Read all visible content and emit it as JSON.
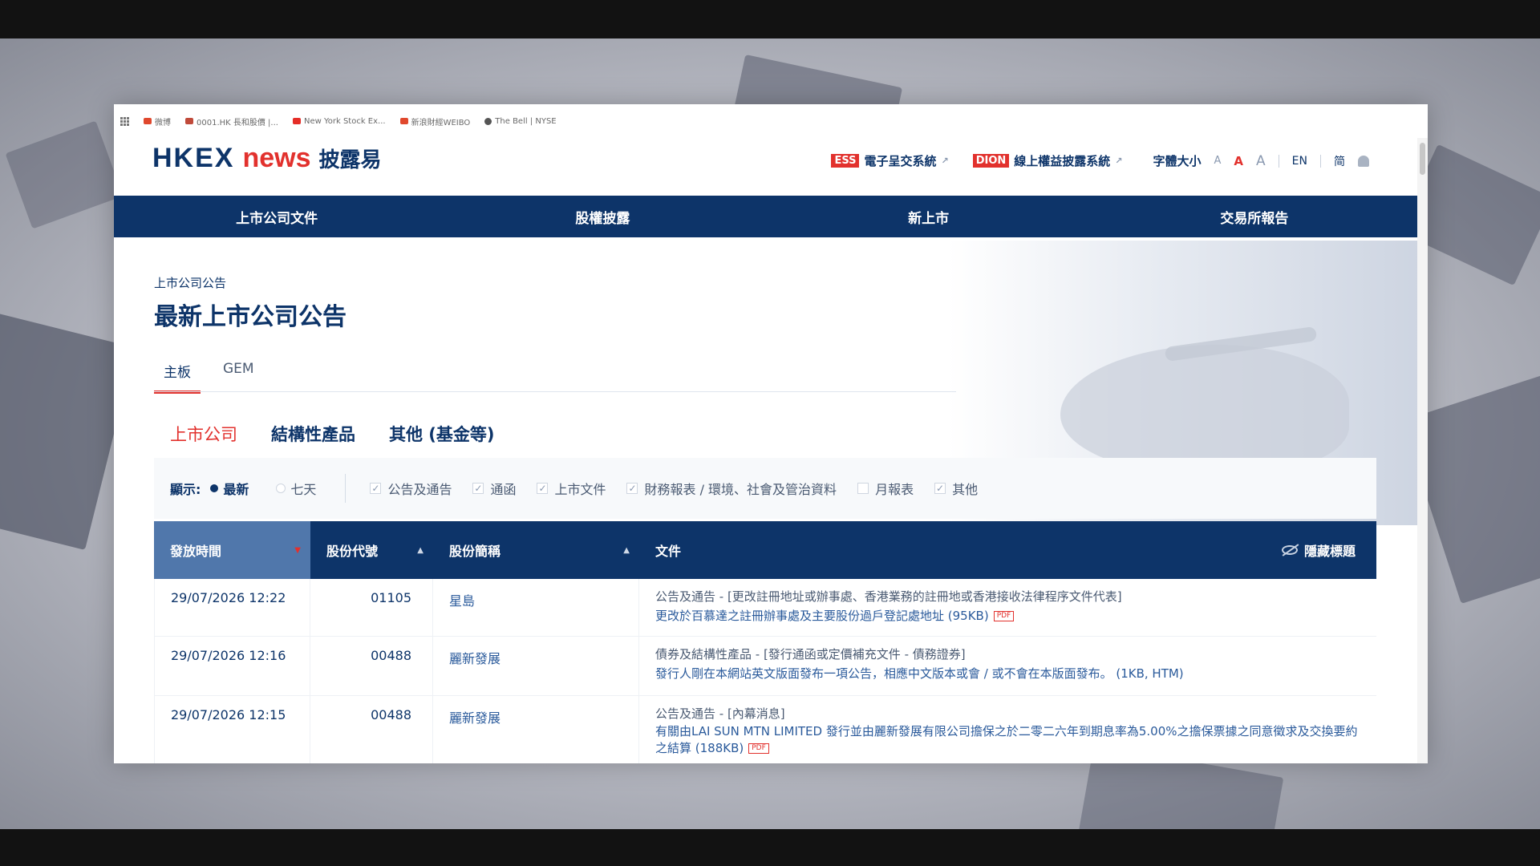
{
  "bookmarks": [
    {
      "icon": "app-grid-icon",
      "label": ""
    },
    {
      "icon": "weibo-icon",
      "label": "微博"
    },
    {
      "icon": "stock-chart-icon",
      "label": "0001.HK 長和股價 |..."
    },
    {
      "icon": "youtube-icon",
      "label": "New York Stock Ex..."
    },
    {
      "icon": "weibo-icon",
      "label": "新浪財經WEIBO"
    },
    {
      "icon": "globe-icon",
      "label": "The Bell | NYSE"
    }
  ],
  "header": {
    "logo_hkex": "HKEX",
    "logo_news": "news",
    "logo_cn": "披露易",
    "ess_tag": "ESS",
    "ess_label": "電子呈交系統",
    "dion_tag": "DION",
    "dion_label": "線上權益披露系統",
    "font_size_label": "字體大小",
    "font_small": "A",
    "font_medium": "A",
    "font_large": "A",
    "lang_en": "EN",
    "lang_sc": "简"
  },
  "nav": [
    "上市公司文件",
    "股權披露",
    "新上市",
    "交易所報告"
  ],
  "breadcrumb": "上市公司公告",
  "page_title": "最新上市公司公告",
  "board_tabs": {
    "main": "主板",
    "gem": "GEM"
  },
  "category_tabs": [
    "上市公司",
    "結構性產品",
    "其他 (基金等)"
  ],
  "filters": {
    "show_label": "顯示:",
    "radio_latest": "最新",
    "radio_seven_days": "七天",
    "checkboxes": [
      {
        "label": "公告及通告",
        "checked": true
      },
      {
        "label": "通函",
        "checked": true
      },
      {
        "label": "上市文件",
        "checked": true
      },
      {
        "label": "財務報表 / 環境、社會及管治資料",
        "checked": true
      },
      {
        "label": "月報表",
        "checked": false
      },
      {
        "label": "其他",
        "checked": true
      }
    ]
  },
  "table": {
    "headers": {
      "release_time": "發放時間",
      "stock_code": "股份代號",
      "stock_name": "股份簡稱",
      "document": "文件",
      "hide_title": "隱藏標題"
    },
    "rows": [
      {
        "time": "29/07/2026 12:22",
        "code": "01105",
        "name": "星島",
        "category": "公告及通告 - [更改註冊地址或辦事處、香港業務的註冊地或香港接收法律程序文件代表]",
        "title": "更改於百慕達之註冊辦事處及主要股份過戶登記處地址 (95KB)",
        "format": "PDF"
      },
      {
        "time": "29/07/2026 12:16",
        "code": "00488",
        "name": "麗新發展",
        "category": "債券及結構性產品 - [發行通函或定價補充文件 - 債務證券]",
        "title": "發行人剛在本網站英文版面發布一項公告，相應中文版本或會 / 或不會在本版面發布。 (1KB, HTM)",
        "format": ""
      },
      {
        "time": "29/07/2026 12:15",
        "code": "00488",
        "name": "麗新發展",
        "category": "公告及通告 - [內幕消息]",
        "title": "有關由LAI SUN MTN LIMITED 發行並由麗新發展有限公司擔保之於二零二六年到期息率為5.00%之擔保票據之同意徵求及交換要約之結算 (188KB)",
        "format": "PDF"
      }
    ]
  },
  "colors": {
    "navy": "#0d3469",
    "red": "#e2312d",
    "sorted_header": "#5077ab"
  }
}
